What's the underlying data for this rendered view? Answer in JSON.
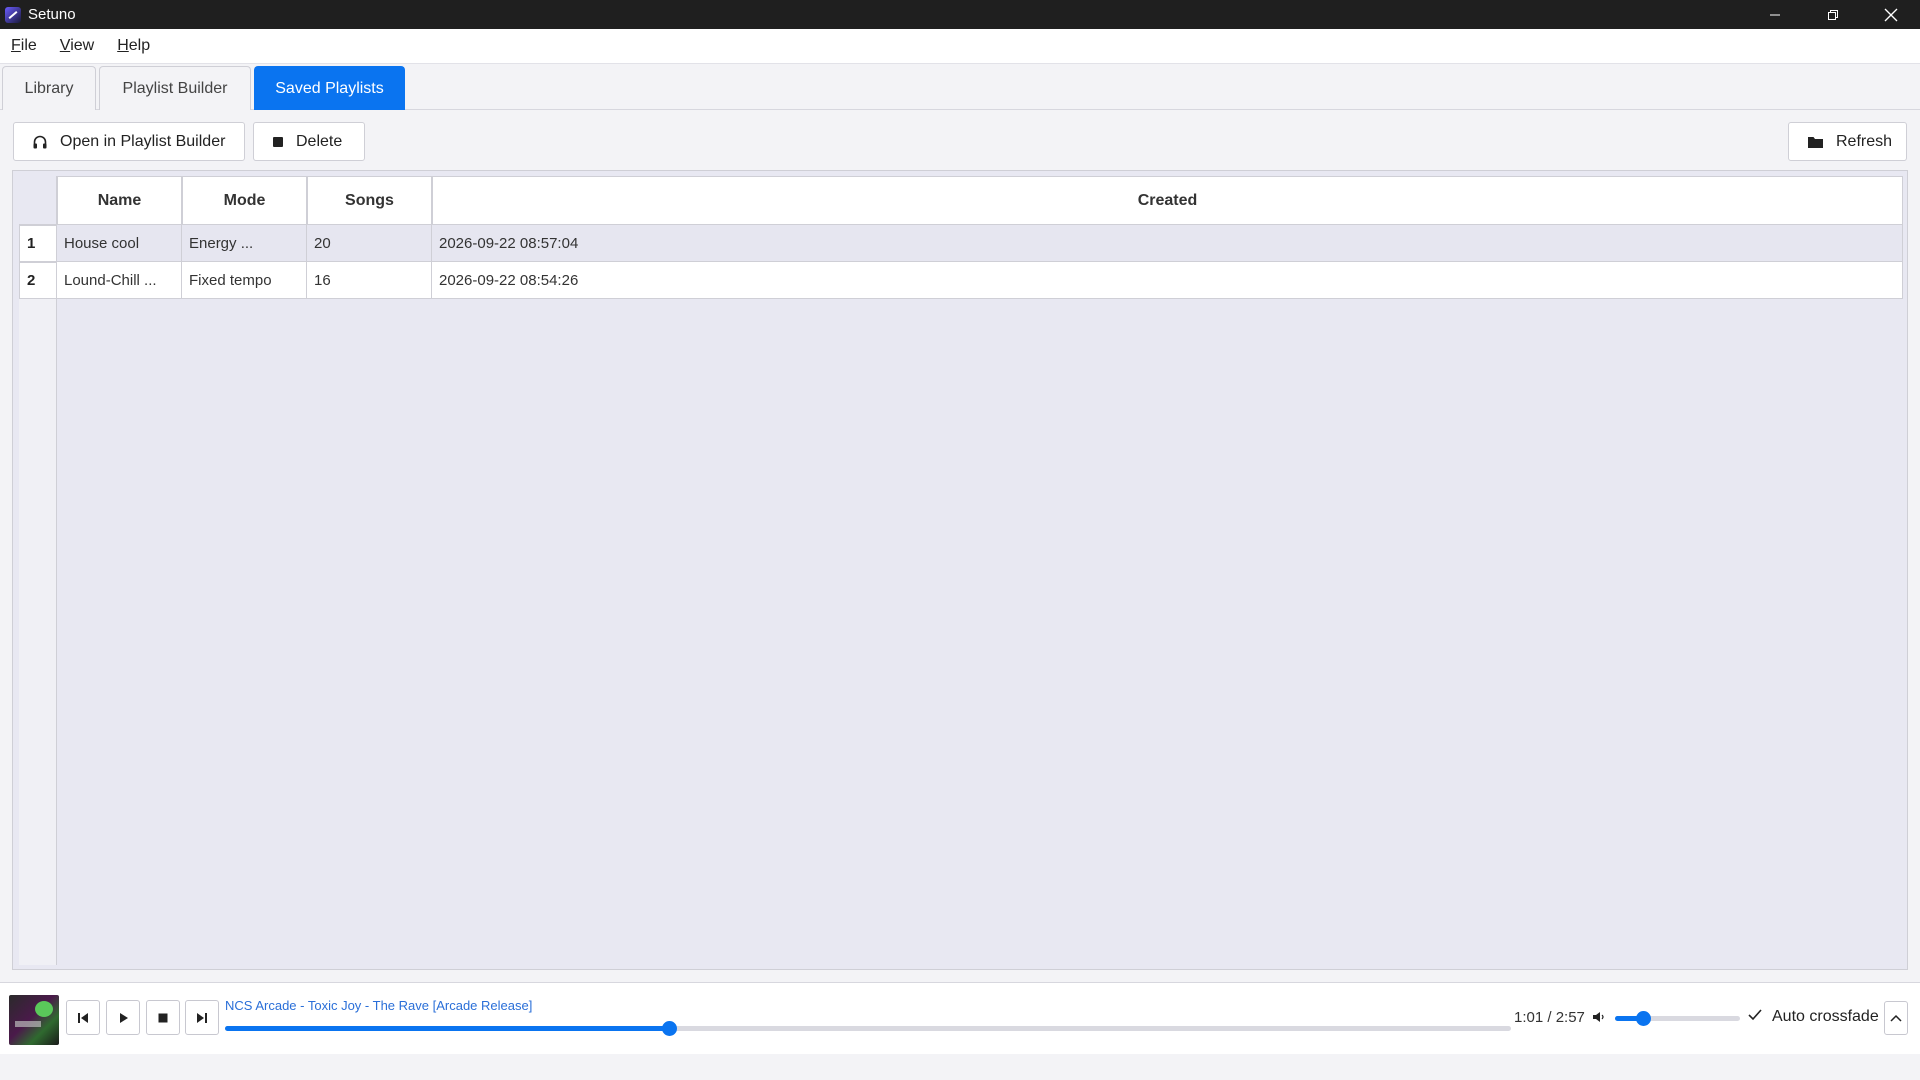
{
  "window": {
    "title": "Setuno"
  },
  "menu": {
    "items": [
      {
        "underline": "F",
        "rest": "ile"
      },
      {
        "underline": "V",
        "rest": "iew"
      },
      {
        "underline": "H",
        "rest": "elp"
      }
    ]
  },
  "tabs": [
    {
      "label": "Library",
      "active": false
    },
    {
      "label": "Playlist Builder",
      "active": false
    },
    {
      "label": "Saved Playlists",
      "active": true
    }
  ],
  "toolbar": {
    "open_label": "Open in Playlist Builder",
    "delete_label": "Delete",
    "refresh_label": "Refresh"
  },
  "table": {
    "columns": [
      "Name",
      "Mode",
      "Songs",
      "Created"
    ],
    "rows": [
      {
        "index": "1",
        "name": "House cool",
        "mode": "Energy ...",
        "songs": "20",
        "created": "2026-09-22 08:57:04"
      },
      {
        "index": "2",
        "name": "Lound-Chill ...",
        "mode": "Fixed tempo",
        "songs": "16",
        "created": "2026-09-22 08:54:26"
      }
    ]
  },
  "player": {
    "track": "NCS Arcade - Toxic Joy - The Rave [Arcade Release]",
    "time": "1:01 / 2:57",
    "progress": 0.345,
    "volume": 0.22,
    "crossfade_label": "Auto crossfade",
    "crossfade_checked": true
  },
  "colors": {
    "accent": "#0a74f0",
    "titlebar": "#1f1f1f",
    "link": "#2a6fd8"
  }
}
